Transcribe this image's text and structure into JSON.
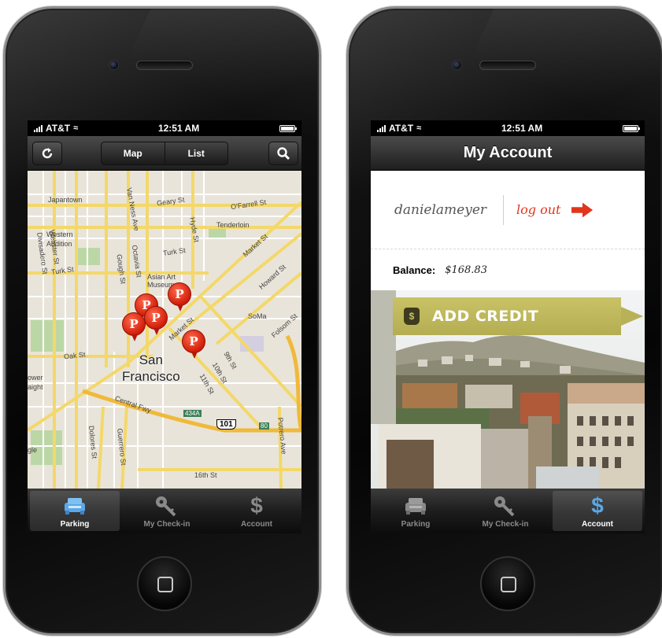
{
  "left_phone": {
    "status": {
      "carrier": "AT&T",
      "time": "12:51 AM"
    },
    "nav": {
      "refresh_icon": "refresh-icon",
      "segments": [
        "Map",
        "List"
      ],
      "search_icon": "search-icon"
    },
    "map": {
      "labels": {
        "japantown": "Japantown",
        "geary": "Geary St",
        "ofarrell": "O'Farrell St",
        "tenderloin": "Tenderloin",
        "western": "Western",
        "addition": "Addition",
        "turk": "Turk St",
        "turk2": "Turk St",
        "market": "Market St",
        "market2": "Market St",
        "soma": "SoMa",
        "oak": "Oak St",
        "folsom": "Folsom St",
        "howard": "Howard St",
        "vanness": "Van Ness Ave",
        "hyde": "Hyde St",
        "gough": "Gough St",
        "octavia": "Octavia St",
        "webster": "Webster St",
        "divisadero": "Divisadero St",
        "dolores": "Dolores St",
        "guerrero": "Guerrero St",
        "potrero": "Potrero Ave",
        "sixteenth": "16th St",
        "ninth": "9th St",
        "tenth": "10th St",
        "eleventh": "11th St",
        "asian_art": "Asian Art",
        "museum": "Museum",
        "central": "Central Fwy",
        "lower": "ower",
        "haight": "aight",
        "gle": "gle",
        "city_line1": "San",
        "city_line2": "Francisco",
        "hwy101": "101",
        "i80": "80",
        "hwy434a": "434A"
      },
      "pin_letter": "P",
      "pin_count": 5
    },
    "tabs": [
      {
        "label": "Parking",
        "icon": "car-icon",
        "active": true
      },
      {
        "label": "My Check-in",
        "icon": "key-icon",
        "active": false
      },
      {
        "label": "Account",
        "icon": "dollar-icon",
        "active": false
      }
    ]
  },
  "right_phone": {
    "status": {
      "carrier": "AT&T",
      "time": "12:51 AM"
    },
    "nav": {
      "title": "My Account"
    },
    "account": {
      "username": "danielameyer",
      "logout_label": "log out",
      "balance_label": "Balance:",
      "balance_value": "$168.83",
      "add_credit_label": "ADD CREDIT",
      "money_bag_glyph": "$"
    },
    "tabs": [
      {
        "label": "Parking",
        "icon": "car-icon",
        "active": false
      },
      {
        "label": "My Check-in",
        "icon": "key-icon",
        "active": false
      },
      {
        "label": "Account",
        "icon": "dollar-icon",
        "active": true
      }
    ]
  },
  "colors": {
    "accent_red": "#e1361b",
    "credit_olive": "#c9c266",
    "tab_active_blue": "#5aa8e8"
  }
}
